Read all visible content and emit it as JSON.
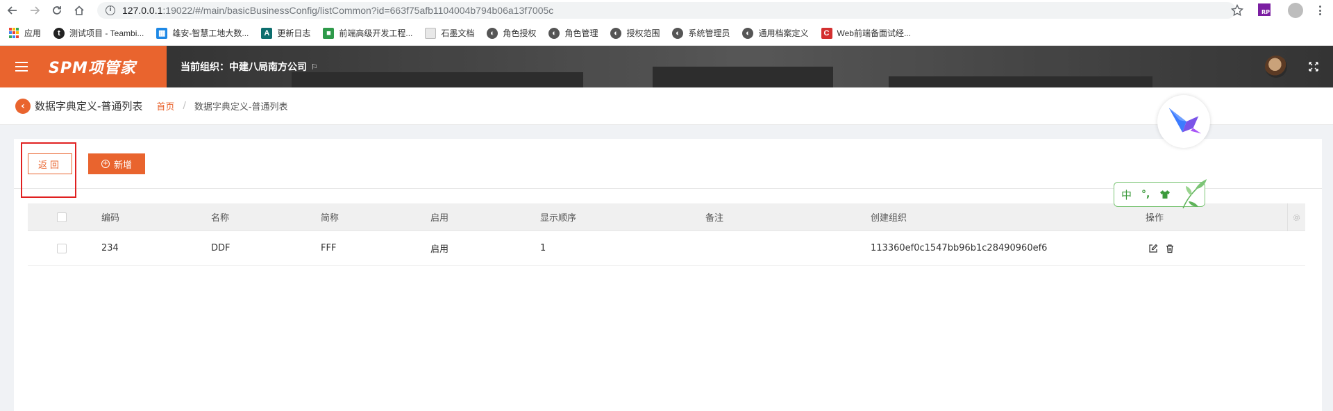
{
  "browser": {
    "url_host": "127.0.0.1",
    "url_rest": ":19022/#/main/basicBusinessConfig/listCommon?id=663f75afb1104004b794b06a13f7005c",
    "extension_label": "RP",
    "bookmarks": [
      {
        "label": "应用",
        "icon": "apps-icon"
      },
      {
        "label": "测试项目 - Teambi...",
        "icon": "teambition-icon"
      },
      {
        "label": "雄安-智慧工地大数...",
        "icon": "bookmark-blue-icon"
      },
      {
        "label": "更新日志",
        "icon": "bookmark-a-icon"
      },
      {
        "label": "前端高级开发工程...",
        "icon": "bookmark-green-icon"
      },
      {
        "label": "石墨文档",
        "icon": "sheet-icon"
      },
      {
        "label": "角色授权",
        "icon": "globe-icon"
      },
      {
        "label": "角色管理",
        "icon": "globe-icon"
      },
      {
        "label": "授权范围",
        "icon": "globe-icon"
      },
      {
        "label": "系统管理员",
        "icon": "globe-icon"
      },
      {
        "label": "通用档案定义",
        "icon": "globe-icon"
      },
      {
        "label": "Web前端备面试经...",
        "icon": "bookmark-c-icon"
      }
    ]
  },
  "header": {
    "logo": "SPM项管家",
    "org_label": "当前组织：中建八局南方公司",
    "flag_icon": "⚐"
  },
  "breadcrumb": {
    "title": "数据字典定义-普通列表",
    "home": "首页",
    "separator": "/",
    "current": "数据字典定义-普通列表"
  },
  "toolbar": {
    "back_label": "返回",
    "add_label": "新增"
  },
  "table": {
    "columns": [
      "编码",
      "名称",
      "简称",
      "启用",
      "显示顺序",
      "备注",
      "创建组织",
      "操作"
    ],
    "rows": [
      {
        "code": "234",
        "name": "DDF",
        "short": "FFF",
        "enabled": "启用",
        "order": "1",
        "remark": "",
        "org": "113360ef0c1547bb96b1c28490960ef6"
      }
    ]
  },
  "ime": {
    "lang": "中",
    "punct": "°,"
  },
  "colors": {
    "accent": "#e9642e",
    "header_bg": "#3b3b3b",
    "highlight_box": "#e02020"
  }
}
